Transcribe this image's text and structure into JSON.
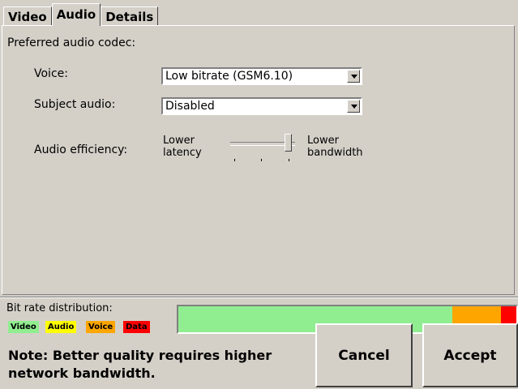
{
  "tabs": [
    {
      "label": "Video",
      "active": false
    },
    {
      "label": "Audio",
      "active": true
    },
    {
      "label": "Details",
      "active": false
    }
  ],
  "audio": {
    "section_label": "Preferred audio codec:",
    "voice_label": "Voice:",
    "voice_value": "Low bitrate (GSM6.10)",
    "subject_label": "Subject audio:",
    "subject_value": "Disabled",
    "efficiency_label": "Audio efficiency:",
    "efficiency_left": "Lower latency",
    "efficiency_right": "Lower bandwidth",
    "efficiency_level": 1.0
  },
  "bitrate": {
    "label": "Bit rate distribution:",
    "legend": [
      {
        "label": "Video",
        "color": "#90ee90"
      },
      {
        "label": "Audio",
        "color": "#ffff00"
      },
      {
        "label": "Voice",
        "color": "#ffa500"
      },
      {
        "label": "Data",
        "color": "#ff0000"
      }
    ],
    "segments": [
      {
        "name": "Video",
        "fraction": 0.81,
        "color": "#90ee90"
      },
      {
        "name": "Audio",
        "fraction": 0.0,
        "color": "#ffff00"
      },
      {
        "name": "Voice",
        "fraction": 0.145,
        "color": "#ffa500"
      },
      {
        "name": "Data",
        "fraction": 0.045,
        "color": "#ff0000"
      }
    ]
  },
  "note": "Note: Better quality requires higher network bandwidth.",
  "buttons": {
    "cancel": "Cancel",
    "accept": "Accept"
  }
}
